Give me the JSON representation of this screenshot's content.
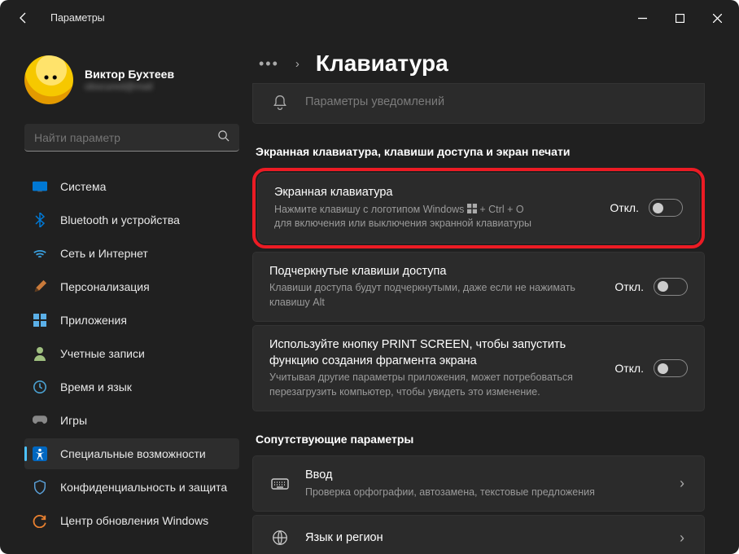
{
  "window": {
    "title": "Параметры"
  },
  "profile": {
    "name": "Виктор Бухтеев",
    "email": "obscured@mail"
  },
  "search": {
    "placeholder": "Найти параметр"
  },
  "nav": [
    {
      "label": "Система",
      "icon": "system"
    },
    {
      "label": "Bluetooth и устройства",
      "icon": "bluetooth"
    },
    {
      "label": "Сеть и Интернет",
      "icon": "network"
    },
    {
      "label": "Персонализация",
      "icon": "personalization"
    },
    {
      "label": "Приложения",
      "icon": "apps"
    },
    {
      "label": "Учетные записи",
      "icon": "accounts"
    },
    {
      "label": "Время и язык",
      "icon": "time"
    },
    {
      "label": "Игры",
      "icon": "gaming"
    },
    {
      "label": "Специальные возможности",
      "icon": "accessibility",
      "active": true
    },
    {
      "label": "Конфиденциальность и защита",
      "icon": "privacy"
    },
    {
      "label": "Центр обновления Windows",
      "icon": "update"
    }
  ],
  "header": {
    "title": "Клавиатура"
  },
  "topcard": {
    "title": "Параметры уведомлений"
  },
  "section1": {
    "heading": "Экранная клавиатура, клавиши доступа и экран печати",
    "items": [
      {
        "title": "Экранная клавиатура",
        "desc1": "Нажмите клавишу с логотипом Windows ",
        "desc2": " + Ctrl + O",
        "desc3": "для включения или выключения экранной клавиатуры",
        "state": "Откл.",
        "highlight": true
      },
      {
        "title": "Подчеркнутые клавиши доступа",
        "desc": "Клавиши доступа будут подчеркнутыми, даже если не нажимать клавишу Alt",
        "state": "Откл."
      },
      {
        "title": "Используйте кнопку PRINT SCREEN, чтобы запустить функцию создания фрагмента экрана",
        "desc": "Учитывая другие параметры приложения, может потребоваться перезагрузить компьютер, чтобы увидеть это изменение.",
        "state": "Откл."
      }
    ]
  },
  "section2": {
    "heading": "Сопутствующие параметры",
    "items": [
      {
        "title": "Ввод",
        "desc": "Проверка орфографии, автозамена, текстовые предложения",
        "icon": "keyboard"
      },
      {
        "title": "Язык и регион",
        "desc": "",
        "icon": "globe"
      }
    ]
  }
}
